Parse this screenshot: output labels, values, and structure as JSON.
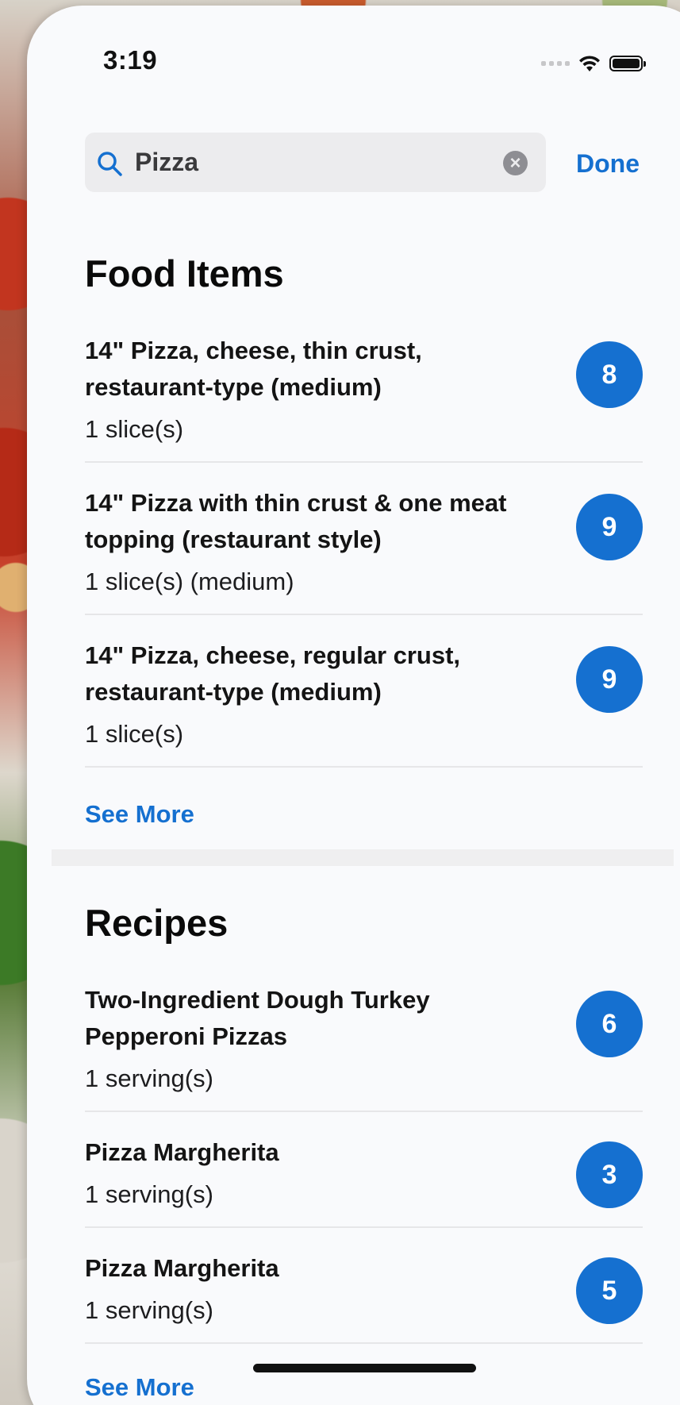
{
  "status_bar": {
    "time": "3:19"
  },
  "search": {
    "query": "Pizza",
    "done_label": "Done"
  },
  "food_items": {
    "title": "Food Items",
    "items": [
      {
        "name": "14\" Pizza, cheese, thin crust, restaurant-type (medium)",
        "serving": "1 slice(s)",
        "points": "8"
      },
      {
        "name": "14\" Pizza with thin crust & one meat topping (restaurant style)",
        "serving": "1 slice(s) (medium)",
        "points": "9"
      },
      {
        "name": "14\" Pizza, cheese, regular crust, restaurant-type (medium)",
        "serving": "1 slice(s)",
        "points": "9"
      }
    ],
    "see_more_label": "See More"
  },
  "recipes": {
    "title": "Recipes",
    "items": [
      {
        "name": "Two-Ingredient Dough Turkey Pepperoni Pizzas",
        "serving": "1 serving(s)",
        "points": "6"
      },
      {
        "name": "Pizza Margherita",
        "serving": "1 serving(s)",
        "points": "3"
      },
      {
        "name": "Pizza Margherita",
        "serving": "1 serving(s)",
        "points": "5"
      }
    ],
    "see_more_label": "See More"
  },
  "colors": {
    "accent": "#1570d0",
    "sheet_background": "#f9fafc",
    "search_background": "#ececee"
  }
}
